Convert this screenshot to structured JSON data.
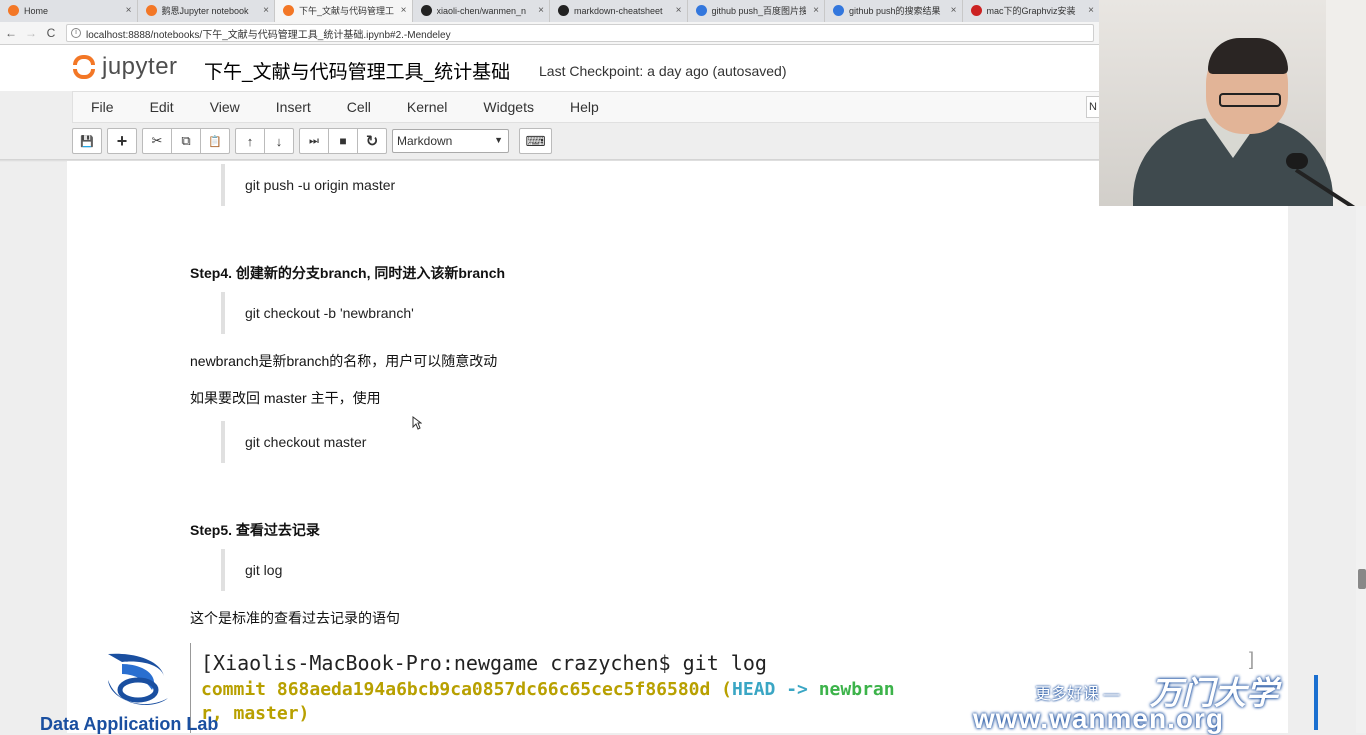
{
  "browser": {
    "tabs": [
      {
        "label": "Home",
        "icon_color": "#f37726",
        "active": false
      },
      {
        "label": "鹅恩Jupyter notebook",
        "icon_color": "#f37726",
        "active": false
      },
      {
        "label": "下午_文献与代码管理工具",
        "icon_color": "#f37726",
        "active": true
      },
      {
        "label": "xiaoli-chen/wanmen_n",
        "icon_color": "#222222",
        "active": false
      },
      {
        "label": "markdown-cheatsheet",
        "icon_color": "#222222",
        "active": false
      },
      {
        "label": "github push_百度图片搜",
        "icon_color": "#3377dd",
        "active": false
      },
      {
        "label": "github push的搜索结果",
        "icon_color": "#3377dd",
        "active": false
      },
      {
        "label": "mac下的Graphviz安装",
        "icon_color": "#cc2222",
        "active": false
      }
    ],
    "tab_close": "×",
    "back": "←",
    "forward": "→",
    "reload": "C",
    "info": "i",
    "url": "localhost:8888/notebooks/下午_文献与代码管理工具_统计基础.ipynb#2.-Mendeley"
  },
  "jupyter": {
    "logo_text": "jupyter",
    "notebook_title": "下午_文献与代码管理工具_统计基础",
    "checkpoint": "Last Checkpoint: a day ago (autosaved)",
    "menu": [
      "File",
      "Edit",
      "View",
      "Insert",
      "Cell",
      "Kernel",
      "Widgets",
      "Help"
    ],
    "kernel_indicator": "N",
    "toolbar": {
      "save": "💾",
      "add": "+",
      "cut": "✂",
      "copy": "⧉",
      "paste": "📋",
      "move_up": "↑",
      "move_down": "↓",
      "run": "⏭",
      "stop": "■",
      "restart": "↻",
      "cell_type": "Markdown",
      "cell_type_caret": "▼",
      "keyboard": "⌨"
    }
  },
  "notebook": {
    "cmd_push": "git push -u origin master",
    "step4_heading": "Step4. 创建新的分支branch, 同时进入该新branch",
    "cmd_checkout_b": "git checkout -b 'newbranch'",
    "para_newbranch": "newbranch是新branch的名称，用户可以随意改动",
    "para_back_master": "如果要改回 master 主干，使用",
    "cmd_checkout_master": "git checkout master",
    "step5_heading": "Step5. 查看过去记录",
    "cmd_log": "git log",
    "para_log": "这个是标准的查看过去记录的语句"
  },
  "terminal": {
    "prompt_line": "[Xiaolis-MacBook-Pro:newgame crazychen$ git log",
    "commit_prefix": "commit 868aeda194a6bcb9ca0857dc66c65cec5f86580d (",
    "head_ref": "HEAD -> ",
    "branch_ref": "newbran",
    "line3": "r, master)",
    "bracket": "]"
  },
  "watermark": {
    "org_name": "Data Application Lab",
    "more_courses": "更多好课 — ",
    "brand": "万门大学",
    "url": "www.wanmen.org",
    "brand_color": "#1a4fa0"
  }
}
